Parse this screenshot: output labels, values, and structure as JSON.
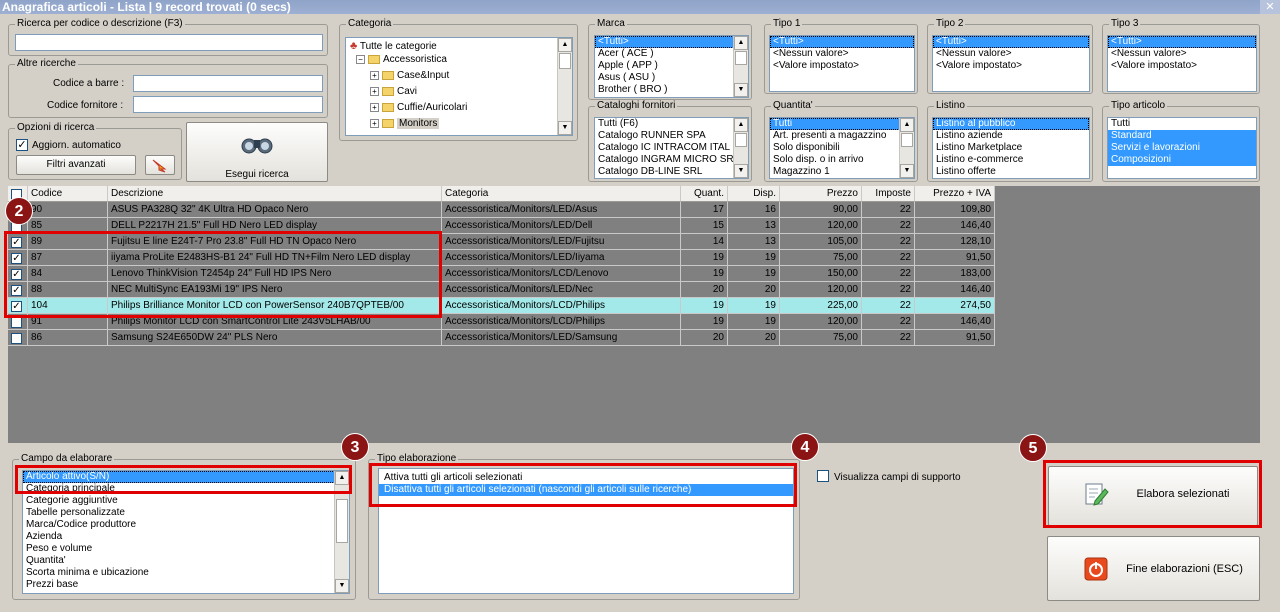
{
  "window": {
    "title": "Anagrafica articoli  - Lista | 9 record trovati (0 secs)",
    "close": "✕"
  },
  "search": {
    "code_desc_label": "Ricerca per codice o descrizione (F3)",
    "code_desc_value": "",
    "other_label": "Altre ricerche",
    "barcode_label": "Codice a barre :",
    "supplier_code_label": "Codice fornitore :",
    "options_label": "Opzioni di ricerca",
    "auto_update_label": "Aggiorn. automatico",
    "auto_update_checked": true,
    "advanced_filters": "Filtri avanzati",
    "run_search": "Esegui ricerca"
  },
  "categoria": {
    "label": "Categoria",
    "all": "Tutte le categorie",
    "root": "Accessoristica",
    "children": [
      "Case&Input",
      "Cavi",
      "Cuffie/Auricolari",
      "Monitors"
    ]
  },
  "filters": {
    "marca": {
      "label": "Marca",
      "items": [
        "<Tutti>",
        "Acer ( ACE )",
        "Apple ( APP )",
        "Asus ( ASU )",
        "Brother ( BRO )"
      ]
    },
    "tipo1": {
      "label": "Tipo 1",
      "items": [
        "<Tutti>",
        "<Nessun valore>",
        "<Valore impostato>"
      ]
    },
    "tipo2": {
      "label": "Tipo 2",
      "items": [
        "<Tutti>",
        "<Nessun valore>",
        "<Valore impostato>"
      ]
    },
    "tipo3": {
      "label": "Tipo 3",
      "items": [
        "<Tutti>",
        "<Nessun valore>",
        "<Valore impostato>"
      ]
    },
    "cataloghi": {
      "label": "Cataloghi fornitori",
      "items": [
        "Tutti (F6)",
        "Catalogo RUNNER SPA",
        "Catalogo IC INTRACOM ITAL",
        "Catalogo INGRAM MICRO SRL",
        "Catalogo DB-LINE SRL"
      ]
    },
    "quantita": {
      "label": "Quantita'",
      "items": [
        "Tutti",
        "Art. presenti a magazzino",
        "Solo disponibili",
        "Solo disp. o in arrivo",
        "Magazzino 1"
      ]
    },
    "listino": {
      "label": "Listino",
      "items": [
        "Listino al pubblico",
        "Listino aziende",
        "Listino Marketplace",
        "Listino e-commerce",
        "Listino offerte"
      ]
    },
    "tipo_articolo": {
      "label": "Tipo articolo",
      "items": [
        "Tutti",
        "Standard",
        "Servizi e lavorazioni",
        "Composizioni"
      ]
    }
  },
  "grid": {
    "headers": [
      "Codice",
      "Descrizione",
      "Categoria",
      "Quant.",
      "Disp.",
      "Prezzo",
      "Imposte",
      "Prezzo + IVA"
    ],
    "rows": [
      {
        "checked": false,
        "codice": "90",
        "descrizione": "ASUS PA328Q 32\" 4K Ultra HD Opaco Nero",
        "categoria": "Accessoristica/Monitors/LED/Asus",
        "quant": "17",
        "disp": "16",
        "prezzo": "90,00",
        "imposte": "22",
        "iva": "109,80"
      },
      {
        "checked": false,
        "codice": "85",
        "descrizione": "DELL P2217H 21.5\" Full HD Nero LED display",
        "categoria": "Accessoristica/Monitors/LED/Dell",
        "quant": "15",
        "disp": "13",
        "prezzo": "120,00",
        "imposte": "22",
        "iva": "146,40"
      },
      {
        "checked": true,
        "codice": "89",
        "descrizione": "Fujitsu E line E24T-7 Pro 23.8\" Full HD TN Opaco Nero",
        "categoria": "Accessoristica/Monitors/LED/Fujitsu",
        "quant": "14",
        "disp": "13",
        "prezzo": "105,00",
        "imposte": "22",
        "iva": "128,10"
      },
      {
        "checked": true,
        "codice": "87",
        "descrizione": "iiyama ProLite E2483HS-B1 24\" Full HD TN+Film Nero LED display",
        "categoria": "Accessoristica/Monitors/LED/Iiyama",
        "quant": "19",
        "disp": "19",
        "prezzo": "75,00",
        "imposte": "22",
        "iva": "91,50"
      },
      {
        "checked": true,
        "codice": "84",
        "descrizione": "Lenovo ThinkVision T2454p 24\" Full HD IPS Nero",
        "categoria": "Accessoristica/Monitors/LCD/Lenovo",
        "quant": "19",
        "disp": "19",
        "prezzo": "150,00",
        "imposte": "22",
        "iva": "183,00"
      },
      {
        "checked": true,
        "codice": "88",
        "descrizione": "NEC MultiSync EA193Mi 19\" IPS Nero",
        "categoria": "Accessoristica/Monitors/LED/Nec",
        "quant": "20",
        "disp": "20",
        "prezzo": "120,00",
        "imposte": "22",
        "iva": "146,40"
      },
      {
        "checked": true,
        "codice": "104",
        "descrizione": "Philips Brilliance Monitor LCD con PowerSensor 240B7QPTEB/00",
        "categoria": "Accessoristica/Monitors/LCD/Philips",
        "quant": "19",
        "disp": "19",
        "prezzo": "225,00",
        "imposte": "22",
        "iva": "274,50"
      },
      {
        "checked": false,
        "codice": "91",
        "descrizione": "Philips Monitor LCD con SmartControl Lite 243V5LHAB/00",
        "categoria": "Accessoristica/Monitors/LCD/Philips",
        "quant": "19",
        "disp": "19",
        "prezzo": "120,00",
        "imposte": "22",
        "iva": "146,40"
      },
      {
        "checked": false,
        "codice": "86",
        "descrizione": "Samsung S24E650DW 24\" PLS Nero",
        "categoria": "Accessoristica/Monitors/LED/Samsung",
        "quant": "20",
        "disp": "20",
        "prezzo": "75,00",
        "imposte": "22",
        "iva": "91,50"
      }
    ]
  },
  "bottom": {
    "campo_label": "Campo da elaborare",
    "campo_items": [
      "Articolo attivo(S/N)",
      "Categoria principale",
      "Categorie aggiuntive",
      "Tabelle personalizzate",
      "Marca/Codice produttore",
      "Azienda",
      "Peso e volume",
      "Quantita'",
      "Scorta minima e ubicazione",
      "Prezzi base"
    ],
    "tipo_label": "Tipo elaborazione",
    "tipo_items": [
      "Attiva tutti gli articoli selezionati",
      "Disattiva tutti gli articoli selezionati (nascondi gli articoli sulle ricerche)"
    ],
    "support_fields_label": "Visualizza campi di supporto",
    "elabora_button": "Elabora selezionati",
    "fine_button": "Fine elaborazioni (ESC)"
  },
  "annotations": [
    "2",
    "3",
    "4",
    "5"
  ]
}
